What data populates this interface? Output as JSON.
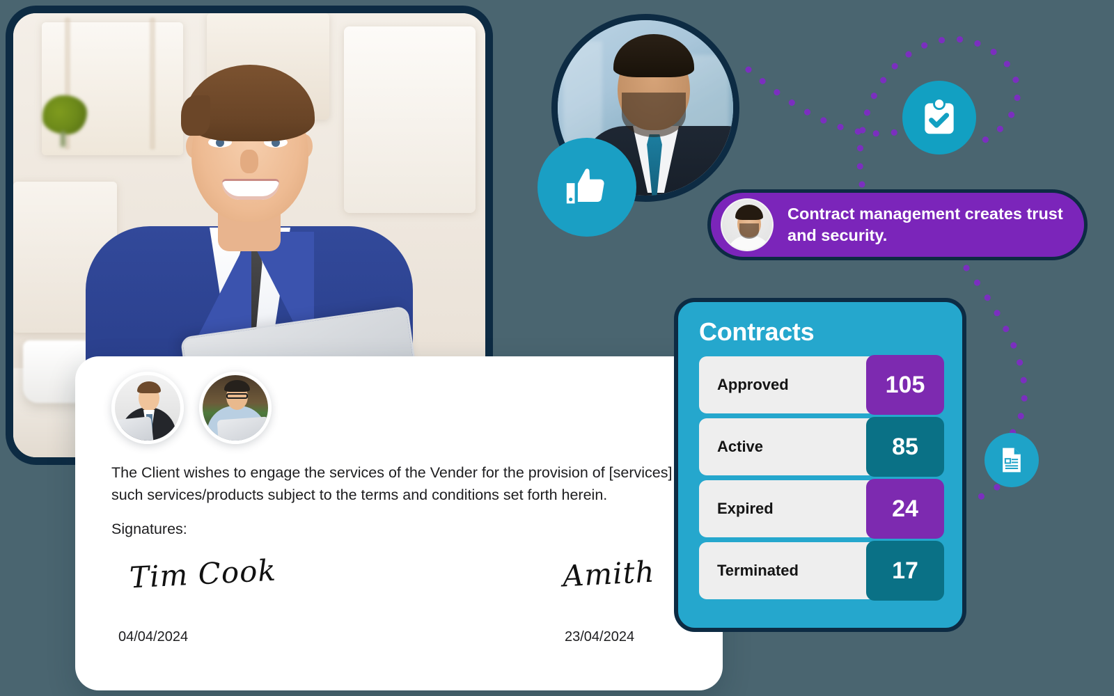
{
  "hero": {
    "photo_alt": "smiling-businessman-with-laptop"
  },
  "circle_photo": {
    "photo_alt": "businessman-using-phone",
    "badge_icon": "thumbs-up-icon"
  },
  "badges": {
    "clipboard_icon": "clipboard-check-icon",
    "document_icon": "document-icon",
    "thumbs_up_icon": "thumbs-up-icon"
  },
  "bubble": {
    "avatar_alt": "smiling-man-avatar",
    "message": "Contract management  creates trust and security."
  },
  "document": {
    "avatar_1_alt": "businessman-avatar",
    "avatar_2_alt": "man-with-glasses-avatar",
    "body_line_1": "The Client wishes to engage the services of the Vender for the provision of [services]",
    "body_line_2": "such services/products subject to the terms and conditions set forth herein.",
    "signatures_label": "Signatures:",
    "signature_left": "Tim Cook",
    "signature_right": "Amith",
    "date_left": "04/04/2024",
    "date_right": "23/04/2024"
  },
  "contracts": {
    "title": "Contracts",
    "rows": [
      {
        "label": "Approved",
        "value": "105",
        "color": "#7d2ab0"
      },
      {
        "label": "Active",
        "value": "85",
        "color": "#0a7186"
      },
      {
        "label": "Expired",
        "value": "24",
        "color": "#7d2ab0"
      },
      {
        "label": "Terminated",
        "value": "17",
        "color": "#0a7186"
      }
    ]
  },
  "colors": {
    "background": "#4a6570",
    "frame_navy": "#0d2b43",
    "accent_cyan": "#25a7cd",
    "accent_purple": "#7b25ba",
    "badge_purple": "#7d2ab0",
    "badge_teal": "#0a7186",
    "dot_purple": "#7b2fbf",
    "card_white": "#ffffff",
    "row_grey": "#eeeeee"
  }
}
